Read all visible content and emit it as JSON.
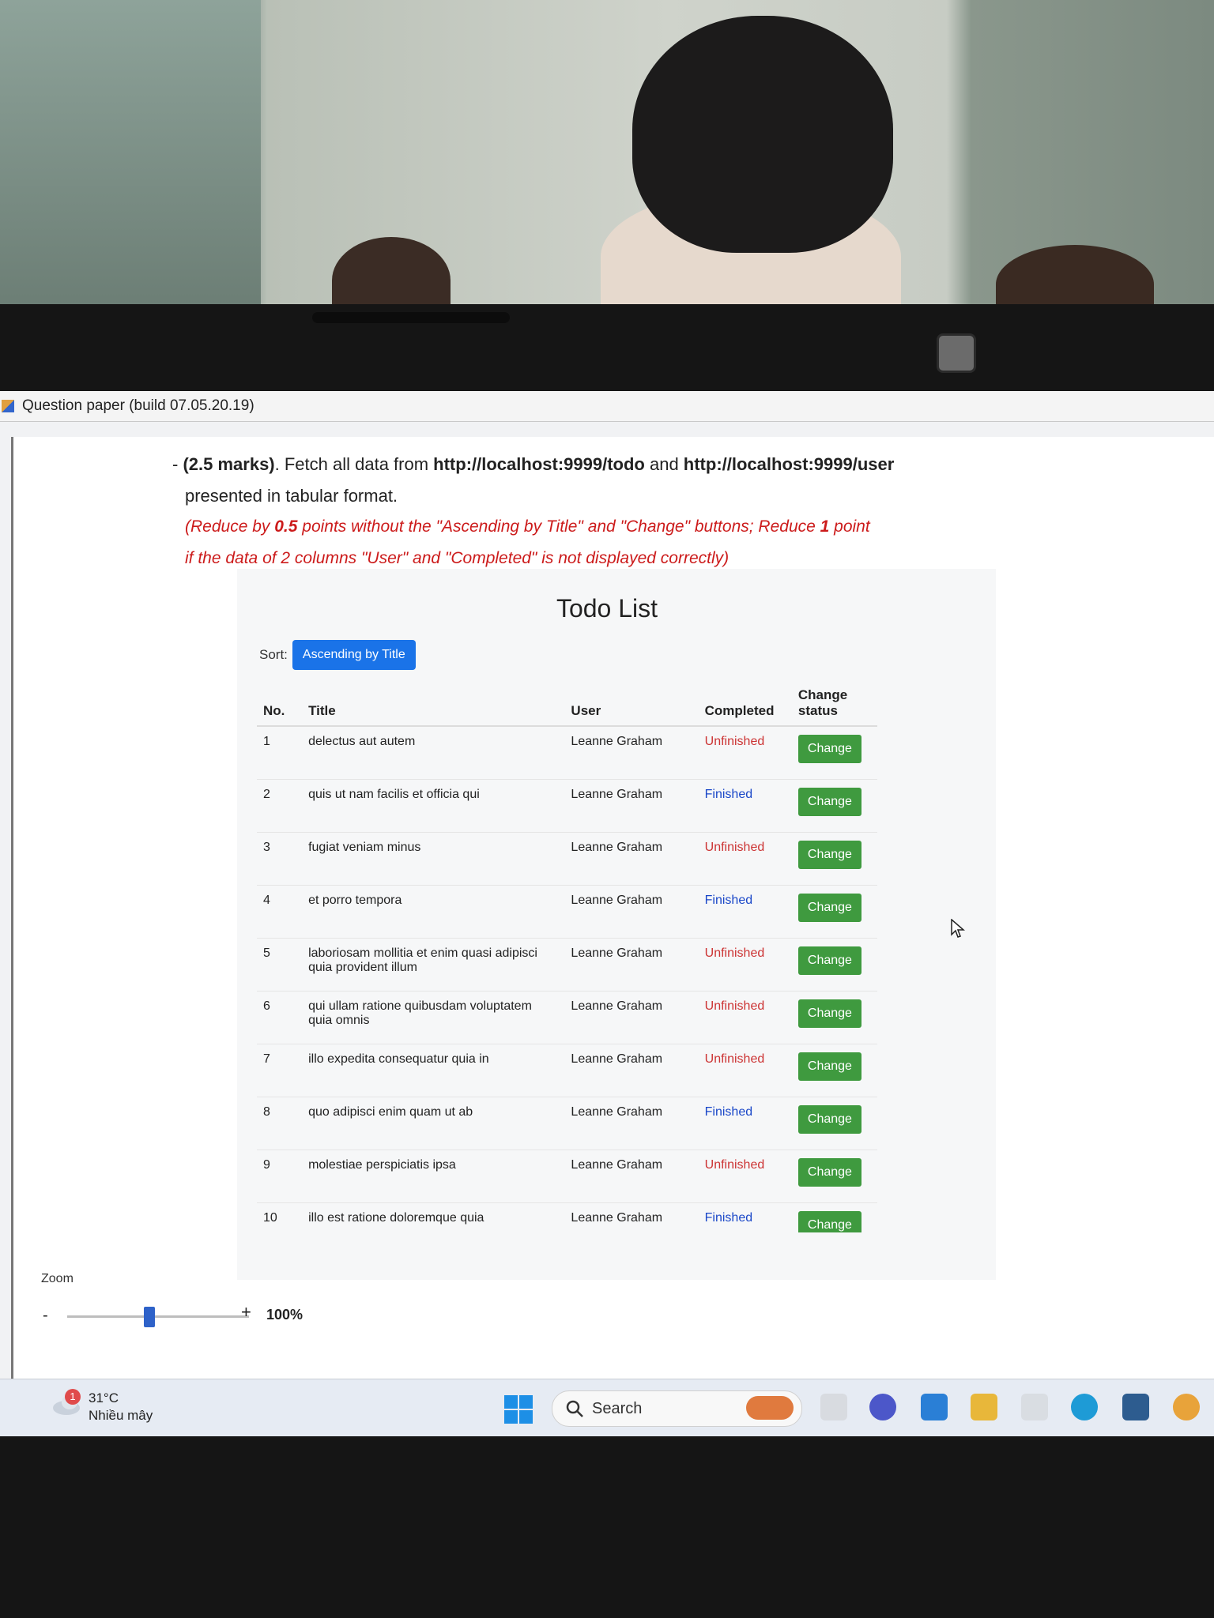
{
  "window": {
    "title": "Question paper (build 07.05.20.19)"
  },
  "question": {
    "bullet": "-",
    "marks": "(2.5 marks)",
    "line1_text": ". Fetch all data from ",
    "url_todo": "http://localhost:9999/todo",
    "and": " and ",
    "url_user": "http://localhost:9999/user",
    "line2": "presented in tabular format.",
    "note_line1_a": "(Reduce by ",
    "note_line1_b": "0.5",
    "note_line1_c": " points without the \"Ascending by Title\" and \"Change\" buttons; Reduce ",
    "note_line1_d": "1",
    "note_line1_e": " point",
    "note_line2": "if the data of 2 columns \"User\" and \"Completed\" is not displayed correctly)"
  },
  "todo": {
    "title": "Todo List",
    "sort_label": "Sort:",
    "sort_button": "Ascending by Title",
    "columns": {
      "no": "No.",
      "title": "Title",
      "user": "User",
      "completed": "Completed",
      "change_status": "Change status"
    },
    "rows": [
      {
        "no": "1",
        "title": "delectus aut autem",
        "user": "Leanne Graham",
        "status": "Unfinished",
        "button": "Change"
      },
      {
        "no": "2",
        "title": "quis ut nam facilis et officia qui",
        "user": "Leanne Graham",
        "status": "Finished",
        "button": "Change"
      },
      {
        "no": "3",
        "title": "fugiat veniam minus",
        "user": "Leanne Graham",
        "status": "Unfinished",
        "button": "Change"
      },
      {
        "no": "4",
        "title": "et porro tempora",
        "user": "Leanne Graham",
        "status": "Finished",
        "button": "Change"
      },
      {
        "no": "5",
        "title": "laboriosam mollitia et enim quasi adipisci quia provident illum",
        "user": "Leanne Graham",
        "status": "Unfinished",
        "button": "Change"
      },
      {
        "no": "6",
        "title": "qui ullam ratione quibusdam voluptatem quia omnis",
        "user": "Leanne Graham",
        "status": "Unfinished",
        "button": "Change"
      },
      {
        "no": "7",
        "title": "illo expedita consequatur quia in",
        "user": "Leanne Graham",
        "status": "Unfinished",
        "button": "Change"
      },
      {
        "no": "8",
        "title": "quo adipisci enim quam ut ab",
        "user": "Leanne Graham",
        "status": "Finished",
        "button": "Change"
      },
      {
        "no": "9",
        "title": "molestiae perspiciatis ipsa",
        "user": "Leanne Graham",
        "status": "Unfinished",
        "button": "Change"
      },
      {
        "no": "10",
        "title": "illo est ratione doloremque quia",
        "user": "Leanne Graham",
        "status": "Finished",
        "button": "Change"
      }
    ]
  },
  "zoom": {
    "label": "Zoom",
    "minus": "-",
    "plus": "+",
    "value": "100%",
    "level": 0.45
  },
  "taskbar": {
    "weather_badge": "1",
    "temperature": "31°C",
    "weather_desc": "Nhiều mây",
    "search_placeholder": "Search"
  },
  "colors": {
    "primary": "#1a73e8",
    "finished": "#1a47c8",
    "unfinished": "#cc3333",
    "change_button": "#3f9a3f",
    "note_red": "#cc1b1b"
  }
}
